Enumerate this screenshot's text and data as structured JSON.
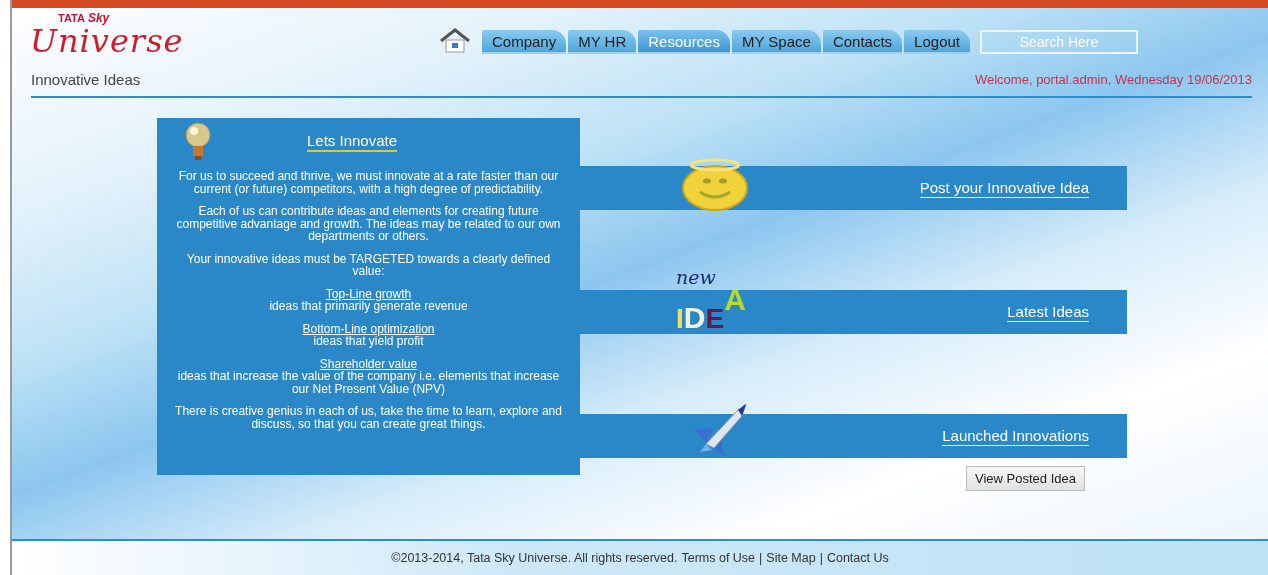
{
  "logo": {
    "brand": "TATA",
    "sub": "Sky",
    "name": "Universe"
  },
  "nav": {
    "tabs": [
      {
        "label": "Company",
        "selected": false
      },
      {
        "label": "MY HR",
        "selected": false
      },
      {
        "label": "Resources",
        "selected": true
      },
      {
        "label": "MY Space",
        "selected": false
      },
      {
        "label": "Contacts",
        "selected": false
      },
      {
        "label": "Logout",
        "selected": false
      }
    ],
    "search": {
      "placeholder": "Search Here"
    }
  },
  "page_title": "Innovative Ideas",
  "welcome": "Welcome, portal.admin, Wednesday 19/06/2013",
  "intro_panel": {
    "title": "Lets Innovate",
    "blocks": [
      {
        "kind": "para",
        "text": "For us to succeed and thrive, we must innovate at a rate faster than our current (or future) competitors, with a high degree of predictability."
      },
      {
        "kind": "para",
        "text": "Each of us can contribute ideas and elements for creating future competitive advantage and growth. The ideas may be related to our own departments or others."
      },
      {
        "kind": "para",
        "text": "Your innovative ideas must be TARGETED towards a clearly defined value:"
      },
      {
        "kind": "topic",
        "heading": "Top-Line growth",
        "text": "ideas that primarily generate revenue"
      },
      {
        "kind": "topic",
        "heading": "Bottom-Line optimization",
        "text": "ideas that yield profit"
      },
      {
        "kind": "topic",
        "heading": "Shareholder value",
        "text": "ideas that increase the value of the company i.e. elements that increase our Net Present Value (NPV)"
      },
      {
        "kind": "para",
        "text": "There is creative genius in each of us, take the time to learn, explore and discuss, so that you can create great things."
      }
    ]
  },
  "sections": [
    {
      "kind": "smiley",
      "label": "Post your Innovative Idea"
    },
    {
      "kind": "new-idea",
      "label": "Latest Ideas",
      "art_text": [
        "new",
        "I",
        "D",
        "E",
        "A"
      ]
    },
    {
      "kind": "rocket",
      "label": "Launched Innovations"
    }
  ],
  "view_button": "View Posted Idea",
  "footer": {
    "copyright": "©2013-2014, Tata Sky Universe. All rights reserved.",
    "links": [
      "Terms of Use",
      "Site Map",
      "Contact Us"
    ],
    "separator": "|"
  }
}
